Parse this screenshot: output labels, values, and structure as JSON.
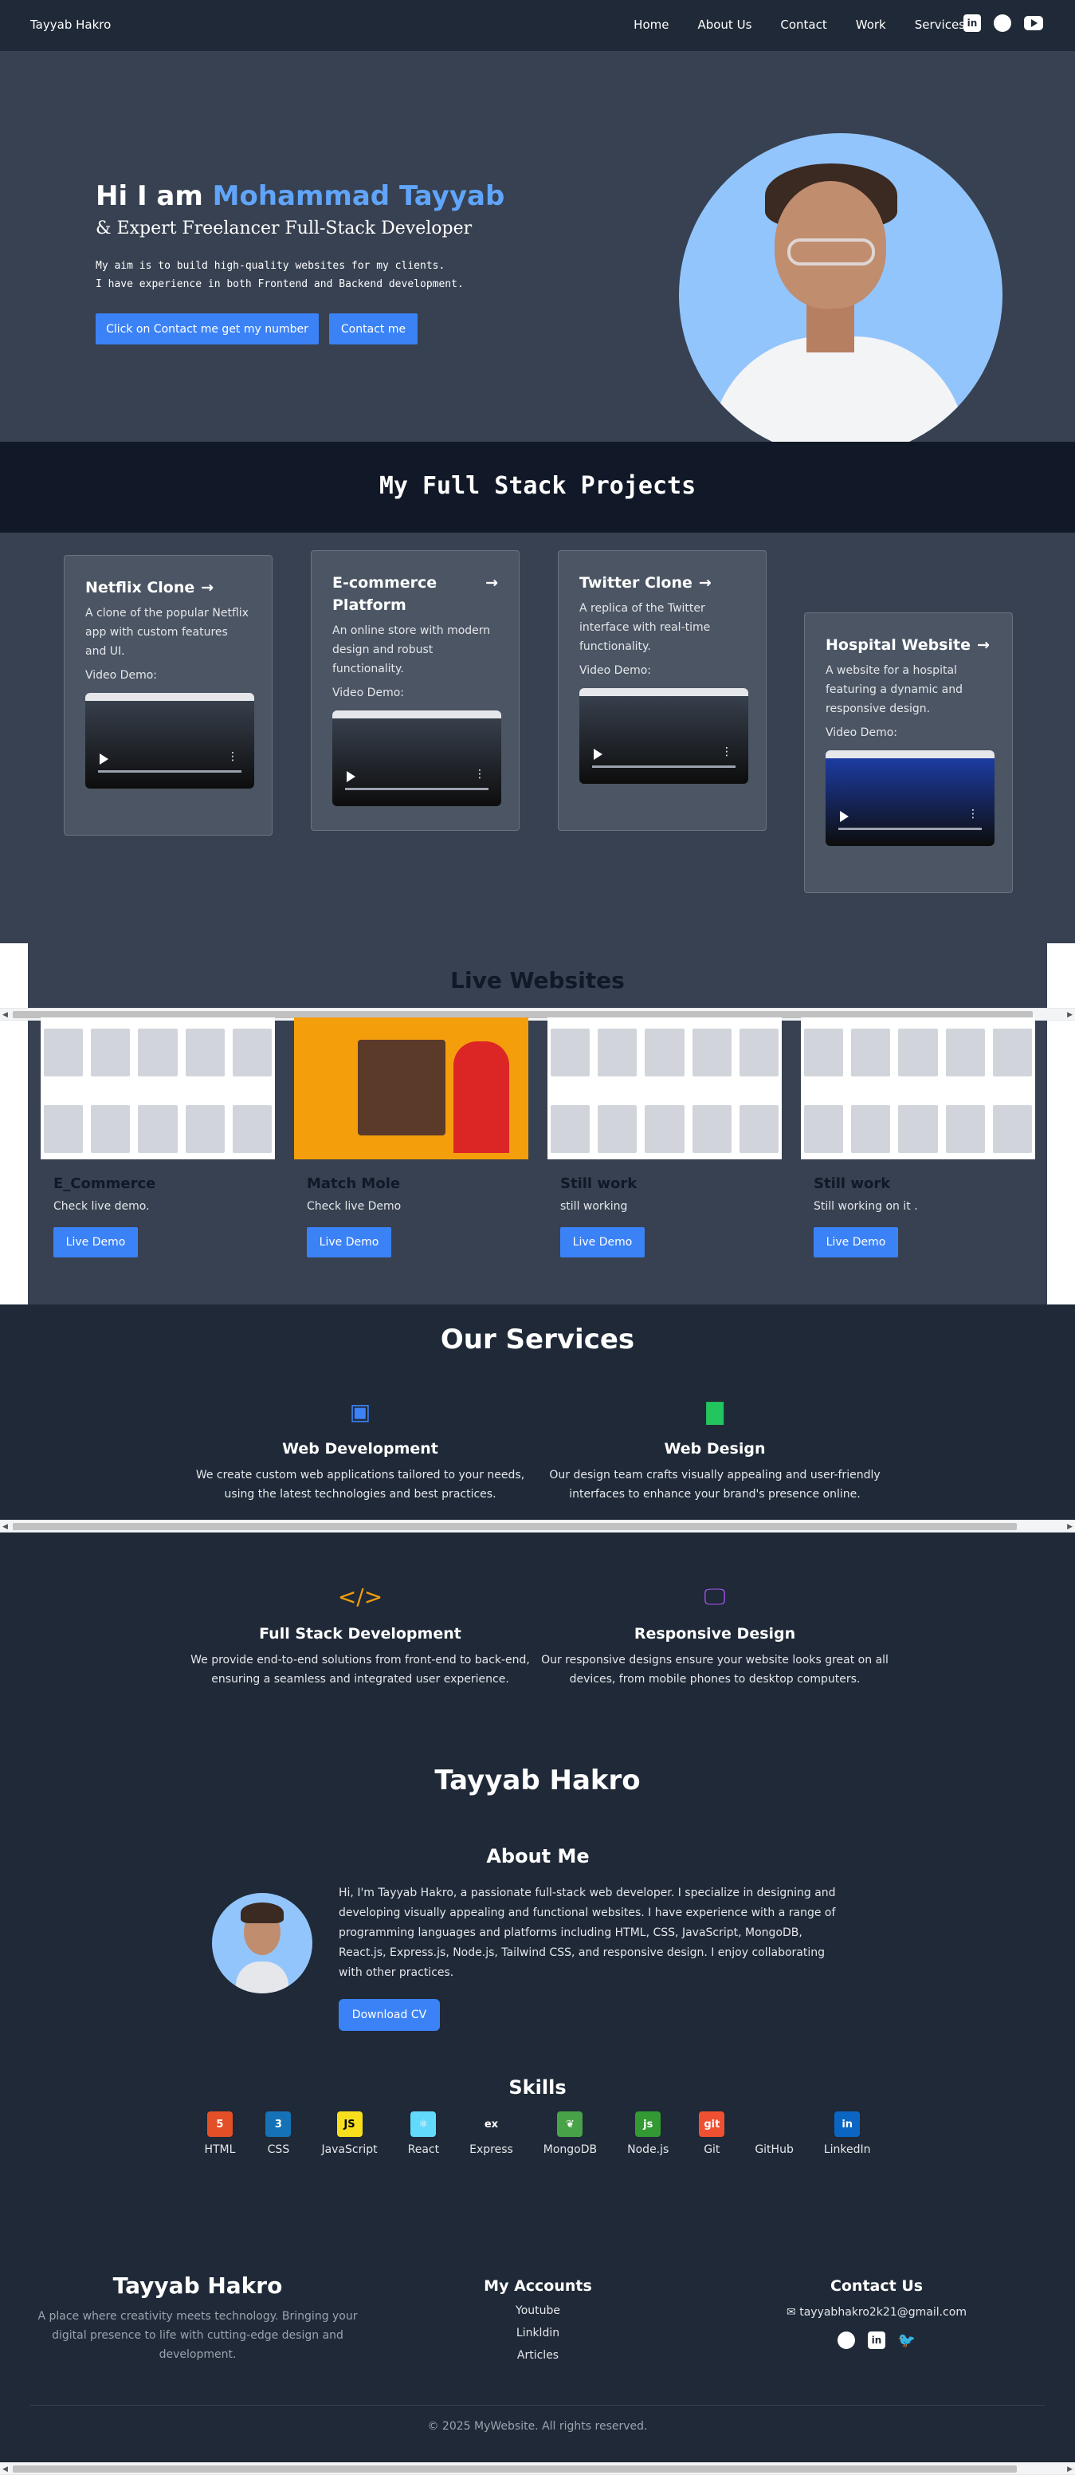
{
  "nav": {
    "brand": "Tayyab Hakro",
    "links": [
      "Home",
      "About Us",
      "Contact",
      "Work",
      "Services"
    ],
    "icons": [
      "linkedin-icon",
      "github-icon",
      "youtube-icon"
    ]
  },
  "hero": {
    "greeting": "Hi I am ",
    "name": "Mohammad Tayyab",
    "subtitle": "& Expert Freelancer Full-Stack Developer",
    "line1": "My aim is to build high-quality websites for my clients.",
    "line2": "I have experience in both Frontend and Backend development.",
    "btn_number": "Click on Contact me get my number",
    "btn_contact": "Contact me"
  },
  "projects": {
    "title": "My Full Stack Projects",
    "video_label": "Video Demo:",
    "items": [
      {
        "title": "Netflix Clone",
        "desc": "A clone of the popular Netflix app with custom features and UI."
      },
      {
        "title": "E-commerce Platform",
        "desc": "An online store with modern design and robust functionality."
      },
      {
        "title": "Twitter Clone",
        "desc": "A replica of the Twitter interface with real-time functionality."
      },
      {
        "title": "Hospital Website",
        "desc": "A website for a hospital featuring a dynamic and responsive design."
      }
    ]
  },
  "live": {
    "title": "Live Websites",
    "items": [
      {
        "title": "E_Commerce",
        "desc": "Check live demo.",
        "btn": "Live Demo"
      },
      {
        "title": "Match Mole",
        "desc": "Check live Demo",
        "btn": "Live Demo"
      },
      {
        "title": "Still work",
        "desc": "still working",
        "btn": "Live Demo"
      },
      {
        "title": "Still work",
        "desc": "Still working on it .",
        "btn": "Live Demo"
      }
    ]
  },
  "services": {
    "title": "Our Services",
    "items": [
      {
        "title": "Web Development",
        "desc": "We create custom web applications tailored to your needs, using the latest technologies and best practices.",
        "icon": "laptop-code-icon",
        "color": "#3b82f6"
      },
      {
        "title": "Web Design",
        "desc": "Our design team crafts visually appealing and user-friendly interfaces to enhance your brand's presence online.",
        "icon": "paint-brush-icon",
        "color": "#22c55e"
      },
      {
        "title": "Full Stack Development",
        "desc": "We provide end-to-end solutions from front-end to back-end, ensuring a seamless and integrated user experience.",
        "icon": "code-icon",
        "color": "#f59e0b"
      },
      {
        "title": "Responsive Design",
        "desc": "Our responsive designs ensure your website looks great on all devices, from mobile phones to desktop computers.",
        "icon": "desktop-icon",
        "color": "#a855f7"
      }
    ]
  },
  "about": {
    "name_title": "Tayyab Hakro",
    "heading": "About Me",
    "text": "Hi, I'm Tayyab Hakro, a passionate full-stack web developer. I specialize in designing and developing visually appealing and functional websites. I have experience with a range of programming languages and platforms including HTML, CSS, JavaScript, MongoDB, React.js, Express.js, Node.js, Tailwind CSS, and responsive design. I enjoy collaborating with other practices.",
    "btn": "Download CV"
  },
  "skills": {
    "title": "Skills",
    "items": [
      {
        "name": "HTML",
        "glyph": "5",
        "color": "#e34f26"
      },
      {
        "name": "CSS",
        "glyph": "3",
        "color": "#1572b6"
      },
      {
        "name": "JavaScript",
        "glyph": "JS",
        "color": "#f7df1e"
      },
      {
        "name": "React",
        "glyph": "⚛",
        "color": "#61dafb"
      },
      {
        "name": "Express",
        "glyph": "ex",
        "color": "#1f2937"
      },
      {
        "name": "MongoDB",
        "glyph": "❦",
        "color": "#47a248"
      },
      {
        "name": "Node.js",
        "glyph": "js",
        "color": "#339933"
      },
      {
        "name": "Git",
        "glyph": "git",
        "color": "#f05032"
      },
      {
        "name": "GitHub",
        "glyph": "",
        "color": "#1f2937"
      },
      {
        "name": "LinkedIn",
        "glyph": "in",
        "color": "#0a66c2"
      }
    ]
  },
  "footer": {
    "brand": "Tayyab Hakro",
    "tagline": "A place where creativity meets technology. Bringing your digital presence to life with cutting-edge design and development.",
    "accounts_title": "My Accounts",
    "accounts": [
      "Youtube",
      "Linkldin",
      "Articles"
    ],
    "contact_title": "Contact Us",
    "email": "tayyabhakro2k21@gmail.com",
    "copyright": "© 2025 MyWebsite. All rights reserved."
  }
}
